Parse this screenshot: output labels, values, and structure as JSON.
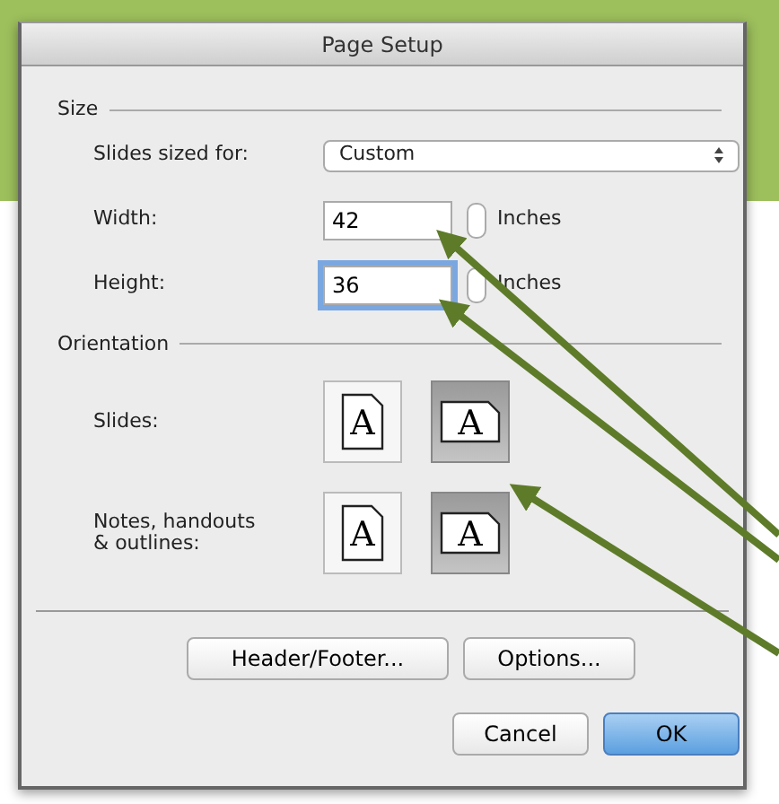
{
  "window": {
    "title": "Page Setup"
  },
  "size": {
    "heading": "Size",
    "sized_for": {
      "label": "Slides sized for:",
      "value": "Custom"
    },
    "fields": [
      {
        "label": "Width:",
        "value": "42",
        "unit": "Inches",
        "focused": false
      },
      {
        "label": "Height:",
        "value": "36",
        "unit": "Inches",
        "focused": true
      }
    ]
  },
  "orientation": {
    "heading": "Orientation",
    "rows": [
      {
        "label": "Slides:",
        "options": [
          {
            "kind": "portrait",
            "glyph": "A",
            "selected": false
          },
          {
            "kind": "landscape",
            "glyph": "A",
            "selected": true
          }
        ]
      },
      {
        "label": "Notes, handouts\n& outlines:",
        "options": [
          {
            "kind": "portrait",
            "glyph": "A",
            "selected": false
          },
          {
            "kind": "landscape",
            "glyph": "A",
            "selected": true
          }
        ]
      }
    ]
  },
  "buttons": [
    {
      "label": "Header/Footer...",
      "default": false
    },
    {
      "label": "Options...",
      "default": false
    }
  ],
  "actions": [
    {
      "label": "Cancel",
      "default": false
    },
    {
      "label": "OK",
      "default": true
    }
  ]
}
